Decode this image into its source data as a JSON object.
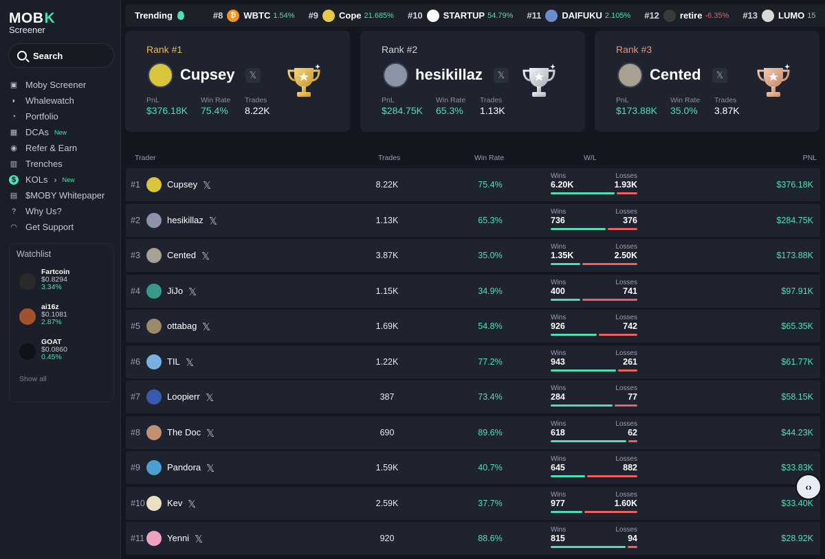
{
  "brand": {
    "logo_main": "MOB",
    "logo_x": "K",
    "logo_sub": "Screener"
  },
  "search": {
    "label": "Search"
  },
  "nav": [
    {
      "label": "Moby Screener",
      "icon": "moby-icon"
    },
    {
      "label": "Whalewatch",
      "icon": "whale-icon"
    },
    {
      "label": "Portfolio",
      "icon": "pie-icon"
    },
    {
      "label": "DCAs",
      "icon": "dca-icon",
      "badge": "New"
    },
    {
      "label": "Refer & Earn",
      "icon": "gift-icon"
    },
    {
      "label": "Trenches",
      "icon": "chart-icon"
    },
    {
      "label": "KOLs",
      "icon": "dollar-icon",
      "badge": "New"
    },
    {
      "label": "$MOBY Whitepaper",
      "icon": "book-icon"
    },
    {
      "label": "Why Us?",
      "icon": "question-icon"
    },
    {
      "label": "Get Support",
      "icon": "headset-icon"
    }
  ],
  "watchlist": {
    "title": "Watchlist",
    "items": [
      {
        "name": "Fartcoin",
        "price": "$0.8294",
        "change": "3.34%",
        "color": "#2a2a2a"
      },
      {
        "name": "ai16z",
        "price": "$0.1081",
        "change": "2.87%",
        "color": "#a0522d"
      },
      {
        "name": "GOAT",
        "price": "$0.0860",
        "change": "0.45%",
        "color": "#0f1218"
      }
    ],
    "show_all": "Show all"
  },
  "trending": {
    "label": "Trending",
    "items": [
      {
        "rank": "#8",
        "name": "WBTC",
        "change": "1.54%",
        "dir": "up",
        "color": "#f7931a",
        "glyph": "₿"
      },
      {
        "rank": "#9",
        "name": "Cope",
        "change": "21.685%",
        "dir": "up",
        "color": "#e8c84a",
        "glyph": ""
      },
      {
        "rank": "#10",
        "name": "STARTUP",
        "change": "54.79%",
        "dir": "up",
        "color": "#ffffff",
        "glyph": ""
      },
      {
        "rank": "#11",
        "name": "DAIFUKU",
        "change": "2.105%",
        "dir": "up",
        "color": "#6a8ccc",
        "glyph": ""
      },
      {
        "rank": "#12",
        "name": "retire",
        "change": "-6.35%",
        "dir": "down",
        "color": "#3a3a3a",
        "glyph": ""
      },
      {
        "rank": "#13",
        "name": "LUMO",
        "change": "15",
        "dir": "up",
        "color": "#d8d8d8",
        "glyph": ""
      }
    ]
  },
  "podium": [
    {
      "rank": "Rank #1",
      "name": "Cupsey",
      "pnl_label": "PnL",
      "pnl": "$376.18K",
      "win_label": "Win Rate",
      "win": "75.4%",
      "trades_label": "Trades",
      "trades": "8.22K",
      "rank_color": "#e8b85a",
      "avatar": "#d9c53c",
      "trophy": "gold"
    },
    {
      "rank": "Rank #2",
      "name": "hesikillaz",
      "pnl_label": "PnL",
      "pnl": "$284.75K",
      "win_label": "Win Rate",
      "win": "65.3%",
      "trades_label": "Trades",
      "trades": "1.13K",
      "rank_color": "#d0d4de",
      "avatar": "#8a93a8",
      "trophy": "silver"
    },
    {
      "rank": "Rank #3",
      "name": "Cented",
      "pnl_label": "PnL",
      "pnl": "$173.88K",
      "win_label": "Win Rate",
      "win": "35.0%",
      "trades_label": "Trades",
      "trades": "3.87K",
      "rank_color": "#e0967a",
      "avatar": "#a8a090",
      "trophy": "bronze"
    }
  ],
  "table": {
    "headers": {
      "trader": "Trader",
      "trades": "Trades",
      "win_rate": "Win Rate",
      "wl": "W/L",
      "pnl": "PNL"
    },
    "wins_label": "Wins",
    "losses_label": "Losses",
    "rows": [
      {
        "rank": "#1",
        "name": "Cupsey",
        "trades": "8.22K",
        "win": "75.4%",
        "wins": "6.20K",
        "losses": "1.93K",
        "win_frac": 0.754,
        "pnl": "$376.18K",
        "avatar": "#d9c53c"
      },
      {
        "rank": "#2",
        "name": "hesikillaz",
        "trades": "1.13K",
        "win": "65.3%",
        "wins": "736",
        "losses": "376",
        "win_frac": 0.653,
        "pnl": "$284.75K",
        "avatar": "#8a93a8"
      },
      {
        "rank": "#3",
        "name": "Cented",
        "trades": "3.87K",
        "win": "35.0%",
        "wins": "1.35K",
        "losses": "2.50K",
        "win_frac": 0.35,
        "pnl": "$173.88K",
        "avatar": "#a8a090"
      },
      {
        "rank": "#4",
        "name": "JiJo",
        "trades": "1.15K",
        "win": "34.9%",
        "wins": "400",
        "losses": "741",
        "win_frac": 0.349,
        "pnl": "$97.91K",
        "avatar": "#3a9a8a"
      },
      {
        "rank": "#5",
        "name": "ottabag",
        "trades": "1.69K",
        "win": "54.8%",
        "wins": "926",
        "losses": "742",
        "win_frac": 0.548,
        "pnl": "$65.35K",
        "avatar": "#9a8a6a"
      },
      {
        "rank": "#6",
        "name": "TIL",
        "trades": "1.22K",
        "win": "77.2%",
        "wins": "943",
        "losses": "261",
        "win_frac": 0.772,
        "pnl": "$61.77K",
        "avatar": "#7ab0e0"
      },
      {
        "rank": "#7",
        "name": "Loopierr",
        "trades": "387",
        "win": "73.4%",
        "wins": "284",
        "losses": "77",
        "win_frac": 0.734,
        "pnl": "$58.15K",
        "avatar": "#3a5ab0"
      },
      {
        "rank": "#8",
        "name": "The Doc",
        "trades": "690",
        "win": "89.6%",
        "wins": "618",
        "losses": "62",
        "win_frac": 0.896,
        "pnl": "$44.23K",
        "avatar": "#c09070"
      },
      {
        "rank": "#9",
        "name": "Pandora",
        "trades": "1.59K",
        "win": "40.7%",
        "wins": "645",
        "losses": "882",
        "win_frac": 0.407,
        "pnl": "$33.83K",
        "avatar": "#4aa0d0"
      },
      {
        "rank": "#10",
        "name": "Kev",
        "trades": "2.59K",
        "win": "37.7%",
        "wins": "977",
        "losses": "1.60K",
        "win_frac": 0.377,
        "pnl": "$33.40K",
        "avatar": "#e8e0c0"
      },
      {
        "rank": "#11",
        "name": "Yenni",
        "trades": "920",
        "win": "88.6%",
        "wins": "815",
        "losses": "94",
        "win_frac": 0.886,
        "pnl": "$28.92K",
        "avatar": "#f0a0c0"
      }
    ]
  },
  "float_button": {
    "label": "‹›"
  },
  "x_glyph": "𝕏"
}
